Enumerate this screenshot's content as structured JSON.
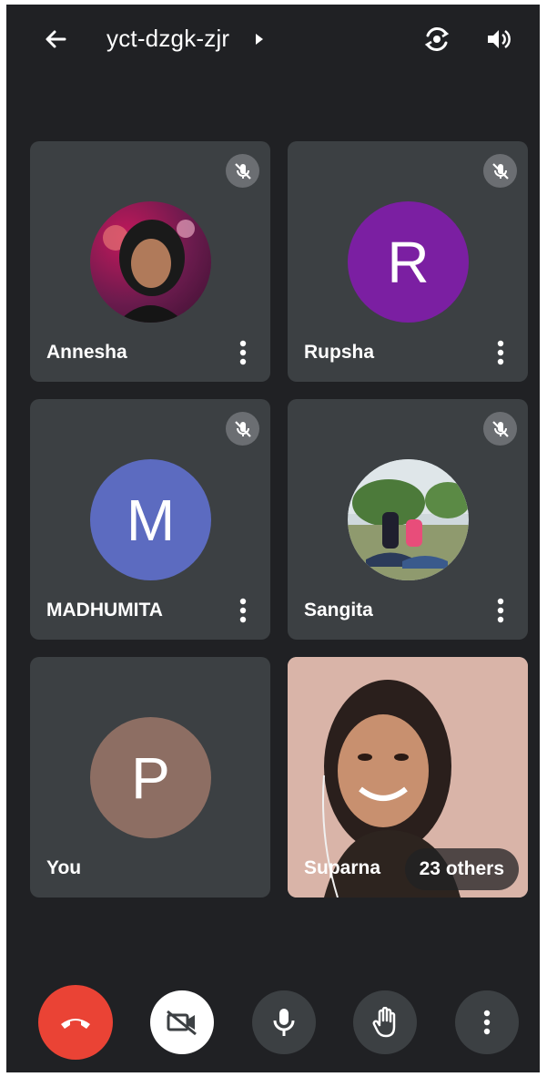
{
  "header": {
    "meeting_code": "yct-dzgk-zjr",
    "back_icon": "arrow-left-icon",
    "switch_camera_icon": "switch-camera-icon",
    "speaker_icon": "volume-icon"
  },
  "participants": [
    {
      "name": "Annesha",
      "avatar_type": "photo",
      "muted": true
    },
    {
      "name": "Rupsha",
      "initial": "R",
      "avatar_color": "#7b1fa2",
      "muted": true
    },
    {
      "name": "MADHUMITA",
      "initial": "M",
      "avatar_color": "#5c6bc0",
      "muted": true
    },
    {
      "name": "Sangita",
      "avatar_type": "photo",
      "muted": true
    },
    {
      "name": "You",
      "initial": "P",
      "avatar_color": "#8d6e63",
      "muted": false
    },
    {
      "name": "Suparna",
      "avatar_type": "video",
      "muted": false
    }
  ],
  "others_badge": "23 others",
  "controls": {
    "end_call_icon": "end-call-icon",
    "camera_icon": "camera-off-icon",
    "mic_icon": "microphone-icon",
    "hand_icon": "raise-hand-icon",
    "more_icon": "more-vertical-icon",
    "end_color": "#ea4335"
  }
}
